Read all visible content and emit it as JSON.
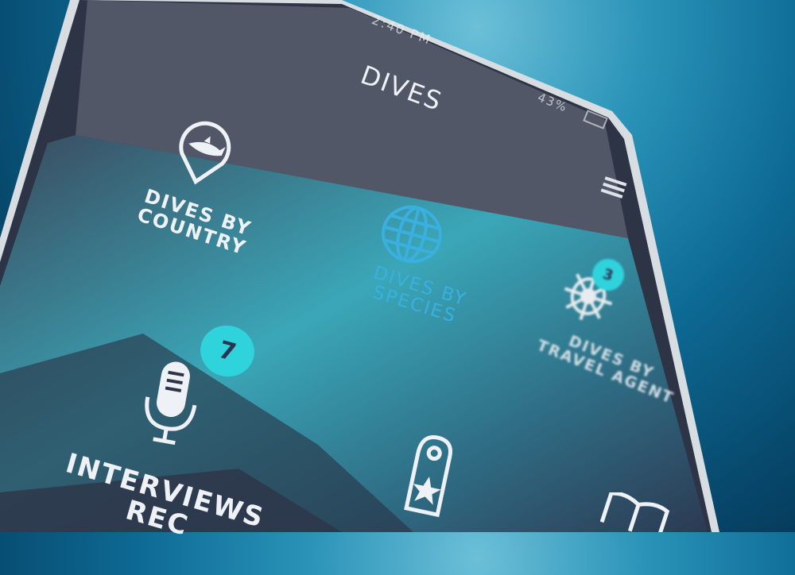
{
  "status_bar": {
    "time": "2:40 PM",
    "battery": "43%"
  },
  "header": {
    "title": "DIVES"
  },
  "menu": [
    {
      "label_line1": "DIVES BY",
      "label_line2": "COUNTRY",
      "icon": "shark-pin-icon",
      "active": false
    },
    {
      "label_line1": "DIVES BY",
      "label_line2": "SPECIES",
      "icon": "globe-icon",
      "active": true
    },
    {
      "label_line1": "DIVES BY",
      "label_line2": "TRAVEL AGENT",
      "icon": "ship-wheel-icon",
      "badge": "3",
      "active": false
    },
    {
      "label_line1": "INTERVIEWS",
      "label_line2": "REC",
      "icon": "microphone-icon",
      "badge": "7",
      "active": false
    },
    {
      "icon": "door-hanger-star-icon"
    },
    {
      "icon": "book-icon"
    }
  ],
  "colors": {
    "accent": "#3ab0e0",
    "badge": "#2fd3dc",
    "screen": "#333a4f"
  }
}
